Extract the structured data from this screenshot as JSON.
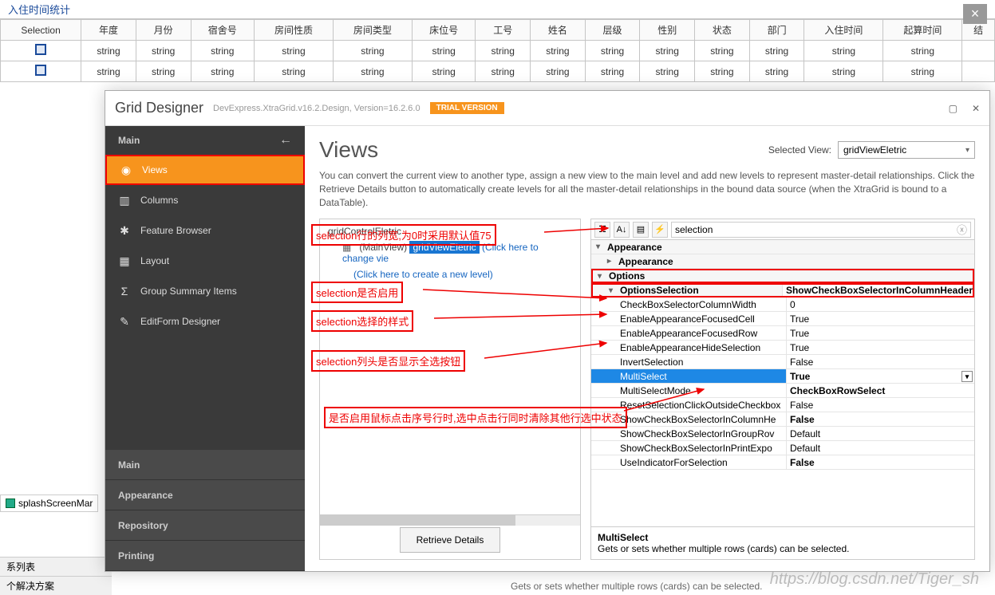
{
  "top": {
    "title": "入住时间统计"
  },
  "grid": {
    "headers": [
      "Selection",
      "年度",
      "月份",
      "宿舍号",
      "房间性质",
      "房间类型",
      "床位号",
      "工号",
      "姓名",
      "层级",
      "性别",
      "状态",
      "部门",
      "入住时间",
      "起算时间",
      "结"
    ],
    "cell": "string"
  },
  "designer": {
    "title": "Grid Designer",
    "subtitle": "DevExpress.XtraGrid.v16.2.Design, Version=16.2.6.0",
    "trial": "TRIAL VERSION",
    "nav_head": "Main",
    "nav": [
      {
        "icon": "views-icon",
        "label": "Views",
        "active": true
      },
      {
        "icon": "columns-icon",
        "label": "Columns"
      },
      {
        "icon": "feature-icon",
        "label": "Feature Browser"
      },
      {
        "icon": "layout-icon",
        "label": "Layout"
      },
      {
        "icon": "sigma-icon",
        "label": "Group Summary Items"
      },
      {
        "icon": "editform-icon",
        "label": "EditForm Designer"
      }
    ],
    "sections": [
      "Main",
      "Appearance",
      "Repository",
      "Printing"
    ],
    "content": {
      "title": "Views",
      "selected_view_label": "Selected View:",
      "selected_view": "gridViewEletric",
      "desc": "You can convert the current view to another type, assign a new view to the main level and add new levels to represent master-detail relationships. Click the Retrieve Details button to automatically create levels for all the master-detail relationships in the bound data source (when the XtraGrid is bound to a DataTable).",
      "tree": {
        "root": "gridControlEletric",
        "main_prefix": "(MainView)",
        "main_view": "gridViewEletric",
        "change_hint": "(Click here to change vie",
        "new_level": "(Click here to create a new level)"
      },
      "retrieve": "Retrieve Details"
    },
    "prop": {
      "search": "selection",
      "cats": {
        "appearance": "Appearance",
        "appearance2": "Appearance",
        "options": "Options",
        "opts_sel": "OptionsSelection"
      },
      "cat_val": "ShowCheckBoxSelectorInColumnHeader",
      "rows": [
        {
          "n": "CheckBoxSelectorColumnWidth",
          "v": "0"
        },
        {
          "n": "EnableAppearanceFocusedCell",
          "v": "True"
        },
        {
          "n": "EnableAppearanceFocusedRow",
          "v": "True"
        },
        {
          "n": "EnableAppearanceHideSelection",
          "v": "True"
        },
        {
          "n": "InvertSelection",
          "v": "False"
        },
        {
          "n": "MultiSelect",
          "v": "True",
          "sel": true
        },
        {
          "n": "MultiSelectMode",
          "v": "CheckBoxRowSelect",
          "bold": true
        },
        {
          "n": "ResetSelectionClickOutsideCheckbox",
          "v": "False"
        },
        {
          "n": "ShowCheckBoxSelectorInColumnHeader",
          "v": "False",
          "bold": true,
          "trunc": "ShowCheckBoxSelectorInColumnHe"
        },
        {
          "n": "ShowCheckBoxSelectorInGroupRow",
          "v": "Default",
          "trunc": "ShowCheckBoxSelectorInGroupRov"
        },
        {
          "n": "ShowCheckBoxSelectorInPrintExport",
          "v": "Default",
          "trunc": "ShowCheckBoxSelectorInPrintExpo"
        },
        {
          "n": "UseIndicatorForSelection",
          "v": "False",
          "bold": true
        }
      ],
      "desc_title": "MultiSelect",
      "desc_text": "Gets or sets whether multiple rows (cards) can be selected."
    }
  },
  "annos": {
    "a1": "selection行的列宽,为0时采用默认值75",
    "a2": "selection是否启用",
    "a3": "selection选择的样式",
    "a4": "selection列头是否显示全选按钮",
    "a5": "是否启用鼠标点击序号行时,选中点击行同时清除其他行选中状态"
  },
  "bottom": {
    "splash": "splashScreenMar",
    "list": "系列表",
    "solution": "个解决方案"
  },
  "watermark": "https://blog.csdn.net/Tiger_sh",
  "crop": "Gets or sets whether multiple rows (cards) can be selected."
}
